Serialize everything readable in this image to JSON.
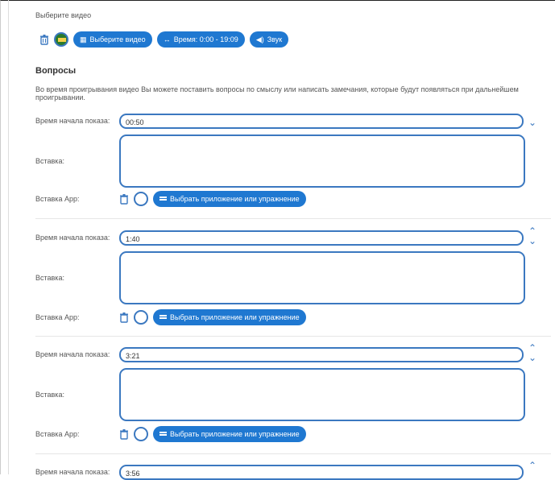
{
  "video": {
    "label": "Выберите видео",
    "select_button": "Выберите видео",
    "time_button": "Время: 0:00 - 19:09",
    "sound_button": "Звук"
  },
  "questions": {
    "title": "Вопросы",
    "description": "Во время проигрывания видео Вы можете поставить вопросы по смыслу или написать замечания, которые будут появляться при дальнейшем проигрывании.",
    "start_label": "Время начала показа:",
    "insert_label": "Вставка:",
    "app_label": "Вставка App:",
    "app_button": "Выбрать приложение или упражнение",
    "items": [
      {
        "time": "00:50",
        "insert": ""
      },
      {
        "time": "1:40",
        "insert": ""
      },
      {
        "time": "3:21",
        "insert": ""
      },
      {
        "time": "3:56",
        "insert": ""
      }
    ]
  },
  "colors": {
    "accent": "#1f78d1",
    "border": "#3b78c0"
  },
  "icons": [
    "trash-icon",
    "film-icon",
    "arrows-icon",
    "speaker-icon",
    "grid-icon",
    "chevron-up-icon",
    "chevron-down-icon"
  ]
}
